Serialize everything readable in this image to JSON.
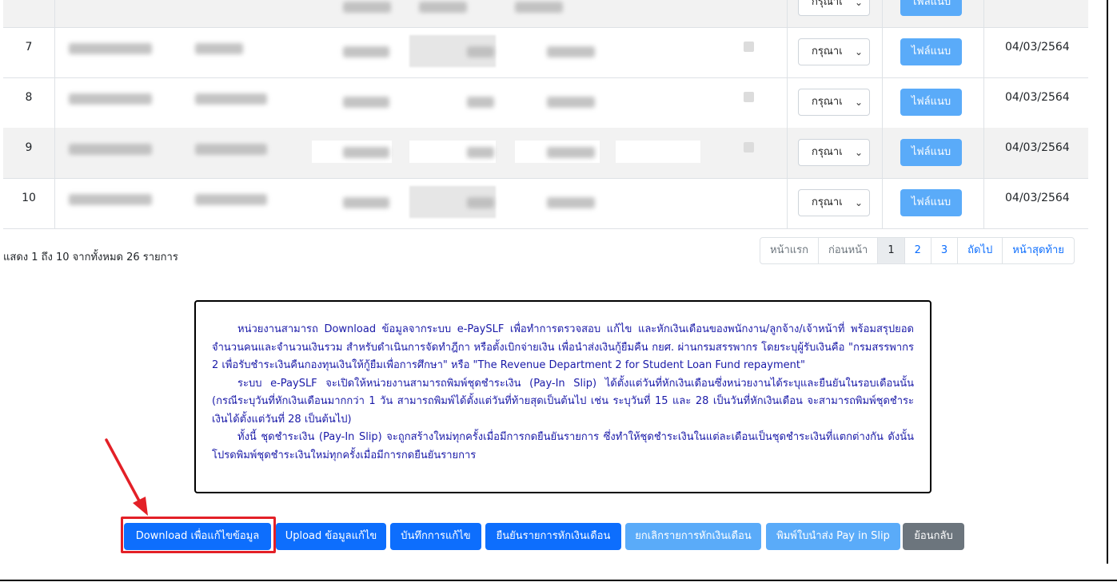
{
  "table": {
    "rows": [
      {
        "index": "",
        "select": "กรุณาเ",
        "file_button": "ไฟล์แนบ",
        "date": ""
      },
      {
        "index": "7",
        "select": "กรุณาเ",
        "file_button": "ไฟล์แนบ",
        "date": "04/03/2564"
      },
      {
        "index": "8",
        "select": "กรุณาเ",
        "file_button": "ไฟล์แนบ",
        "date": "04/03/2564"
      },
      {
        "index": "9",
        "select": "กรุณาเ",
        "file_button": "ไฟล์แนบ",
        "date": "04/03/2564"
      },
      {
        "index": "10",
        "select": "กรุณาเ",
        "file_button": "ไฟล์แนบ",
        "date": "04/03/2564"
      }
    ]
  },
  "info_text": "แสดง 1 ถึง 10 จากทั้งหมด 26 รายการ",
  "pagination": {
    "first": "หน้าแรก",
    "prev": "ก่อนหน้า",
    "pages": [
      "1",
      "2",
      "3"
    ],
    "current": "1",
    "next": "ถัดไป",
    "last": "หน้าสุดท้าย"
  },
  "notice": {
    "p1": "หน่วยงานสามารถ Download ข้อมูลจากระบบ e-PaySLF เพื่อทำการตรวจสอบ แก้ไข และหักเงินเดือนของพนักงาน/ลูกจ้าง/เจ้าหน้าที่ พร้อมสรุปยอดจำนวนคนและจำนวนเงินรวม สำหรับดำเนินการจัดทำฎีกา หรือตั้งเบิกจ่ายเงิน เพื่อนำส่งเงินกู้ยืมคืน กยศ. ผ่านกรมสรรพากร โดยระบุผู้รับเงินคือ \"กรมสรรพากร 2 เพื่อรับชำระเงินคืนกองทุนเงินให้กู้ยืมเพื่อการศึกษา\" หรือ \"The Revenue Department 2 for Student Loan Fund repayment\"",
    "p2": "ระบบ e-PaySLF จะเปิดให้หน่วยงานสามารถพิมพ์ชุดชำระเงิน (Pay-In Slip) ได้ตั้งแต่วันที่หักเงินเดือนซึ่งหน่วยงานได้ระบุและยืนยันในรอบเดือนนั้น (กรณีระบุวันที่หักเงินเดือนมากกว่า 1 วัน สามารถพิมพ์ได้ตั้งแต่วันที่ท้ายสุดเป็นต้นไป เช่น ระบุวันที่ 15 และ 28 เป็นวันที่หักเงินเดือน จะสามารถพิมพ์ชุดชำระเงินได้ตั้งแต่วันที่ 28 เป็นต้นไป)",
    "p3": "ทั้งนี้ ชุดชำระเงิน (Pay-In Slip) จะถูกสร้างใหม่ทุกครั้งเมื่อมีการกดยืนยันรายการ ซึ่งทำให้ชุดชำระเงินในแต่ละเดือนเป็นชุดชำระเงินที่แตกต่างกัน ดังนั้น โปรดพิมพ์ชุดชำระเงินใหม่ทุกครั้งเมื่อมีการกดยืนยันรายการ"
  },
  "actions": {
    "download": "Download เพื่อแก้ไขข้อมูล",
    "upload": "Upload ข้อมูลแก้ไข",
    "save": "บันทึกการแก้ไข",
    "confirm": "ยืนยันรายการหักเงินเดือน",
    "cancel": "ยกเลิกรายการหักเงินเดือน",
    "print": "พิมพ์ใบนำส่ง Pay in Slip",
    "back": "ย้อนกลับ"
  },
  "colors": {
    "primary": "#0d6efd",
    "primary_disabled": "#5aabf9",
    "secondary": "#6c757d",
    "highlight": "#e32027",
    "notice_text": "#1a1aa8"
  }
}
